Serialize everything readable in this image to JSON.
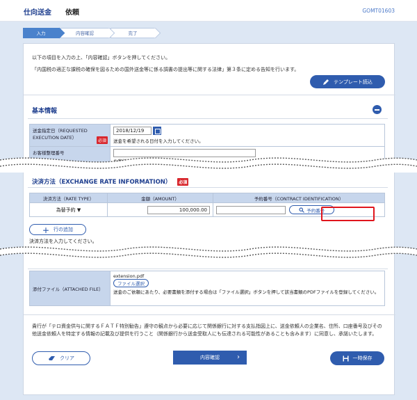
{
  "header": {
    "title": "仕向送金",
    "subtitle": "依頼",
    "screen_code": "GOMT01603"
  },
  "steps": [
    {
      "label": "入力"
    },
    {
      "label": "内容確認"
    },
    {
      "label": "完了"
    }
  ],
  "intro": {
    "line1": "以下の項目を入力の上、「内容確認」ボタンを押してください。",
    "line2": "「内国税の適正な課税の確保を図るための国外送金等に係る調書の提出等に関する法律」第３条に定める告知を行います。"
  },
  "template_button": "テンプレート読込",
  "basic_info": {
    "title": "基本情報",
    "date_label": "送金指定日（REQUESTED EXECUTION DATE）",
    "required": "必須",
    "date_value": "2018/12/19",
    "date_hint": "送金を希望される日付を入力してください。",
    "ref_label": "お客様整理番号",
    "ref_hint": "お客様の整理番号を入力してください。"
  },
  "payment": {
    "title": "決済方法（EXCHANGE RATE INFORMATION）",
    "required": "必須",
    "col_method": "決済方法（RATE TYPE）",
    "col_amount": "金額（AMOUNT）",
    "col_contract": "予約番号（CONTRACT IDENTIFICATION）",
    "method_value": "為替予約",
    "amount_value": "100,000.00",
    "contract_button": "予約番号",
    "add_row": "行の追加",
    "hint": "決済方法を入力してください。"
  },
  "attachment": {
    "label": "添付ファイル（ATTACHED FILE）",
    "file_name": "extension.pdf",
    "file_button": "ファイル選択",
    "hint": "送金のご依頼にあたり、必要書類を添付する場合は「ファイル選択」ボタンを押して該当書類のPDFファイルを登録してください。"
  },
  "notice": "貴行が「テロ資金供与に関するＦＡＴＦ特別勧告」遵守の観点から必要に応じて関係銀行に対する支払指図上に、送金依頼人の企業名、住所、口座番号及びその他送金依頼人を特定する情報の記載及び提供を行うこと（関係銀行から送金受取人にも伝達される可能性があることも含みます）に同意し、承諾いたします。",
  "buttons": {
    "clear": "クリア",
    "confirm": "内容確認",
    "save": "一時保存"
  },
  "colors": {
    "primary": "#2f5cae",
    "label_bg": "#c7d6ec",
    "required": "#d8262c",
    "highlight": "#e0151c",
    "page_bg": "#dde7f4"
  }
}
